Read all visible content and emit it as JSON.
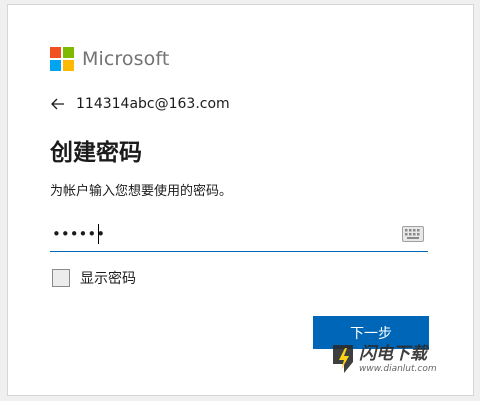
{
  "brand": {
    "name": "Microsoft",
    "colors": [
      "#f25022",
      "#7fba00",
      "#00a4ef",
      "#ffb900"
    ]
  },
  "identity": {
    "back_icon": "arrow-left-icon",
    "email": "114314abc@163.com"
  },
  "page": {
    "title": "创建密码",
    "description": "为帐户输入您想要使用的密码。"
  },
  "password": {
    "value": "••••••",
    "keyboard_icon": "keyboard-icon"
  },
  "show_password": {
    "label": "显示密码",
    "checked": false
  },
  "actions": {
    "next_label": "下一步"
  },
  "accent_color": "#0067b8",
  "watermark": {
    "name": "闪电下载",
    "url": "www.dianlut.com"
  }
}
